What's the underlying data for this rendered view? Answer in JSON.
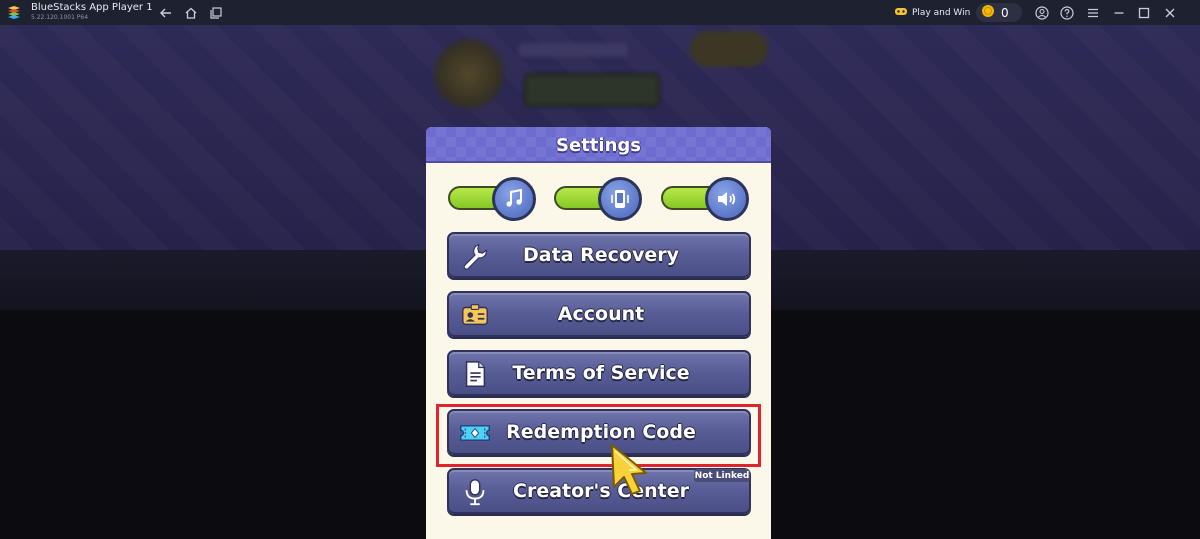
{
  "titlebar": {
    "app_name": "BlueStacks App Player 1",
    "app_version": "5.22.120.1001  P64",
    "play_and_win_label": "Play and Win",
    "coin_count": "0",
    "icons": [
      "bluestacks-logo-icon",
      "back-arrow-icon",
      "home-icon",
      "multi-window-icon",
      "game-controller-icon",
      "coin-icon",
      "account-icon",
      "help-icon",
      "menu-icon",
      "minimize-icon",
      "maximize-icon",
      "close-icon"
    ]
  },
  "settings": {
    "title": "Settings",
    "toggles": [
      {
        "name": "music",
        "icon": "music-note-icon",
        "state": "on"
      },
      {
        "name": "vibration",
        "icon": "vibration-icon",
        "state": "on"
      },
      {
        "name": "sound",
        "icon": "speaker-icon",
        "state": "on"
      }
    ],
    "buttons": [
      {
        "label": "Data Recovery",
        "icon": "wrench-icon"
      },
      {
        "label": "Account",
        "icon": "id-card-icon"
      },
      {
        "label": "Terms of Service",
        "icon": "document-icon"
      },
      {
        "label": "Redemption Code",
        "icon": "ticket-icon",
        "highlighted": true
      },
      {
        "label": "Creator's Center",
        "icon": "microphone-icon",
        "badge": "Not Linked"
      }
    ]
  },
  "colors": {
    "titlebar_bg": "#1e2130",
    "dialog_header": "#6e6cd0",
    "dialog_bg": "#fbf8ea",
    "button_bg": "#575c95",
    "toggle_on": "#9ad834",
    "highlight_border": "#e0242f"
  }
}
